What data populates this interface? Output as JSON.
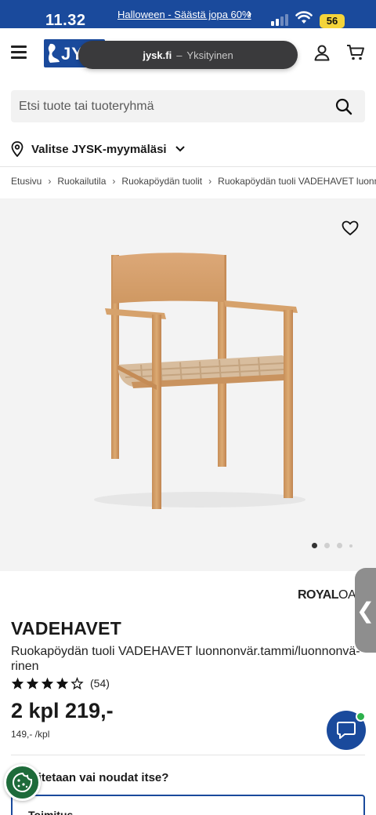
{
  "status_bar": {
    "time": "11.32",
    "promo": "Halloween - Säästä jopa 60%",
    "battery": "56"
  },
  "browser": {
    "url": "jysk.fi",
    "separator": "–",
    "mode": "Yksityinen"
  },
  "header": {
    "logo_text": "JYSK"
  },
  "search": {
    "placeholder": "Etsi tuote tai tuoteryhmä"
  },
  "store": {
    "label": "Valitse JYSK-myymäläsi"
  },
  "breadcrumb": [
    "Etusivu",
    "Ruokailutila",
    "Ruokapöydän tuolit",
    "Ruokapöydän tuoli VADEHAVET luonnonvär.tammi/luonnonväri"
  ],
  "gallery": {
    "image_count": 4,
    "active_index": 0
  },
  "product": {
    "brand": "ROYALOAK",
    "brand_bold": "ROYAL",
    "brand_light": "OAK",
    "name": "VADEHAVET",
    "description": "Ruokapöydän tuoli VADEHAVET luonnonvär.tammi/luonnonvä-rinen",
    "rating": 4,
    "rating_max": 5,
    "review_count": "(54)",
    "price": "2 kpl 219,-",
    "unit_price": "149,- /kpl"
  },
  "delivery": {
    "question": "Toimitetaan vai noudat itse?",
    "option": "Toimitus"
  },
  "colors": {
    "brand_blue": "#1a4a9c",
    "battery": "#f4d43a",
    "online": "#2db14c",
    "cookie": "#1e6b3a"
  }
}
